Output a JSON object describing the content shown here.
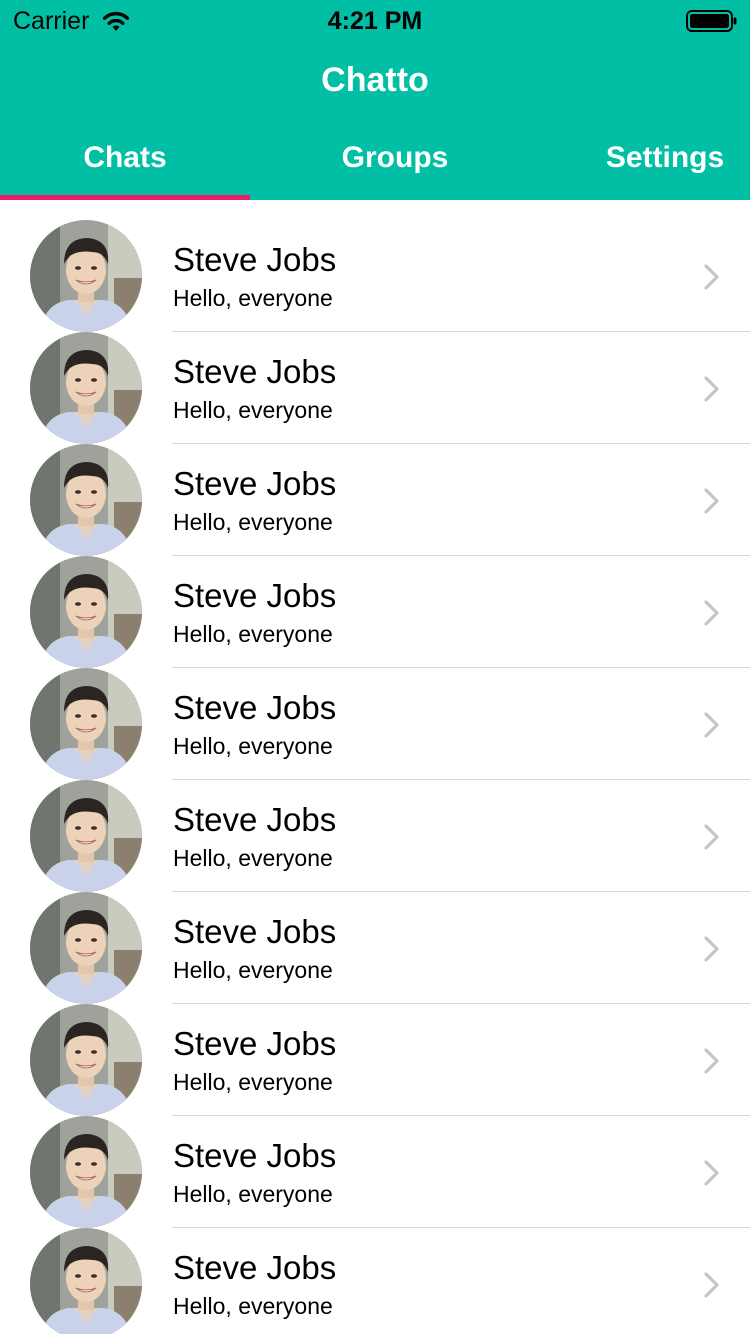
{
  "status_bar": {
    "carrier": "Carrier",
    "time": "4:21 PM"
  },
  "header": {
    "title": "Chatto",
    "background_color": "#00BFA5",
    "indicator_color": "#E91E63"
  },
  "tabs": [
    {
      "label": "Chats",
      "active": true
    },
    {
      "label": "Groups",
      "active": false
    },
    {
      "label": "Settings",
      "active": false
    }
  ],
  "chats": [
    {
      "name": "Steve Jobs",
      "message": "Hello, everyone"
    },
    {
      "name": "Steve Jobs",
      "message": "Hello, everyone"
    },
    {
      "name": "Steve Jobs",
      "message": "Hello, everyone"
    },
    {
      "name": "Steve Jobs",
      "message": "Hello, everyone"
    },
    {
      "name": "Steve Jobs",
      "message": "Hello, everyone"
    },
    {
      "name": "Steve Jobs",
      "message": "Hello, everyone"
    },
    {
      "name": "Steve Jobs",
      "message": "Hello, everyone"
    },
    {
      "name": "Steve Jobs",
      "message": "Hello, everyone"
    },
    {
      "name": "Steve Jobs",
      "message": "Hello, everyone"
    },
    {
      "name": "Steve Jobs",
      "message": "Hello, everyone"
    }
  ]
}
